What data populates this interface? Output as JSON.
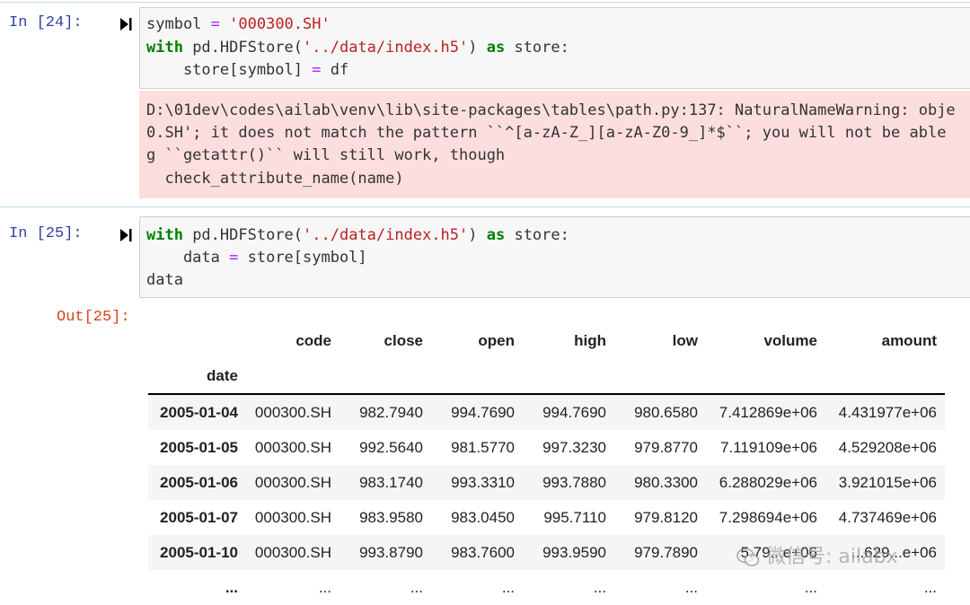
{
  "cell24": {
    "prompt": "In  [24]:",
    "code": {
      "l1_var": "symbol",
      "l1_eq": " = ",
      "l1_str": "'000300.SH'",
      "l2_kw": "with",
      "l2_a": " pd.HDFStore(",
      "l2_str": "'../data/index.h5'",
      "l2_b": ") ",
      "l2_kw2": "as",
      "l2_c": " store:",
      "l3_a": "    store[symbol] ",
      "l3_eq": "=",
      "l3_b": " df"
    },
    "stderr": [
      "D:\\01dev\\codes\\ailab\\venv\\lib\\site-packages\\tables\\path.py:137: NaturalNameWarning: obje",
      "0.SH'; it does not match the pattern ``^[a-zA-Z_][a-zA-Z0-9_]*$``; you will not be able",
      "g ``getattr()`` will still work, though",
      "  check_attribute_name(name)"
    ]
  },
  "cell25": {
    "prompt": "In  [25]:",
    "code": {
      "l1_kw": "with",
      "l1_a": " pd.HDFStore(",
      "l1_str": "'../data/index.h5'",
      "l1_b": ") ",
      "l1_kw2": "as",
      "l1_c": " store:",
      "l2_a": "    data ",
      "l2_eq": "=",
      "l2_b": " store[symbol]",
      "l3": "data"
    },
    "out_prompt": "Out[25]:",
    "table": {
      "columns": [
        "code",
        "close",
        "open",
        "high",
        "low",
        "volume",
        "amount"
      ],
      "index_name": "date",
      "rows": [
        [
          "2005-01-04",
          "000300.SH",
          "982.7940",
          "994.7690",
          "994.7690",
          "980.6580",
          "7.412869e+06",
          "4.431977e+06"
        ],
        [
          "2005-01-05",
          "000300.SH",
          "992.5640",
          "981.5770",
          "997.3230",
          "979.8770",
          "7.119109e+06",
          "4.529208e+06"
        ],
        [
          "2005-01-06",
          "000300.SH",
          "983.1740",
          "993.3310",
          "993.7880",
          "980.3300",
          "6.288029e+06",
          "3.921015e+06"
        ],
        [
          "2005-01-07",
          "000300.SH",
          "983.9580",
          "983.0450",
          "995.7110",
          "979.8120",
          "7.298694e+06",
          "4.737469e+06"
        ],
        [
          "2005-01-10",
          "000300.SH",
          "993.8790",
          "983.7600",
          "993.9590",
          "979.7890",
          "5.79...e+06",
          "...629...e+06"
        ]
      ],
      "ellipsis": "..."
    }
  },
  "watermark": "微信号: ailabx",
  "icons": {
    "run": "run-cell-icon",
    "watermark": "wechat-icon"
  }
}
